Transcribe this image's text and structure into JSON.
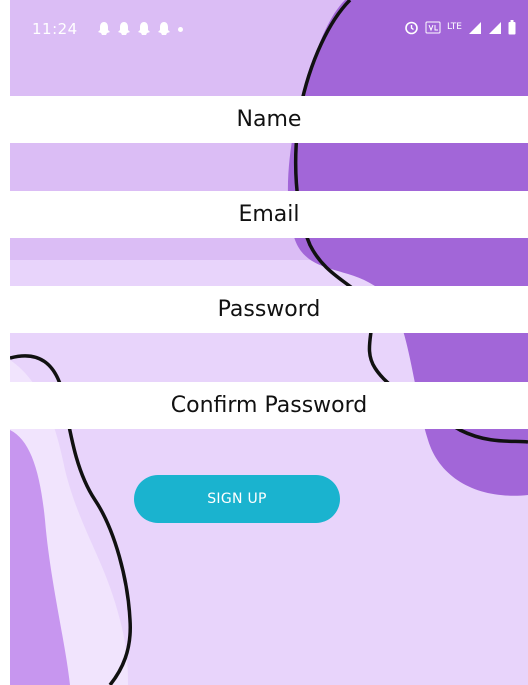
{
  "status_bar": {
    "time": "11:24",
    "net_label": "LTE",
    "notification_icons": [
      "snapchat-icon",
      "snapchat-icon",
      "snapchat-icon",
      "snapchat-icon"
    ]
  },
  "form": {
    "name_label": "Name",
    "email_label": "Email",
    "password_label": "Password",
    "confirm_password_label": "Confirm Password",
    "signup_label": "SIGN UP"
  },
  "colors": {
    "background": "#e8d4fb",
    "blob": "#a266d8",
    "button": "#1ab3cf",
    "field": "#ffffff"
  }
}
